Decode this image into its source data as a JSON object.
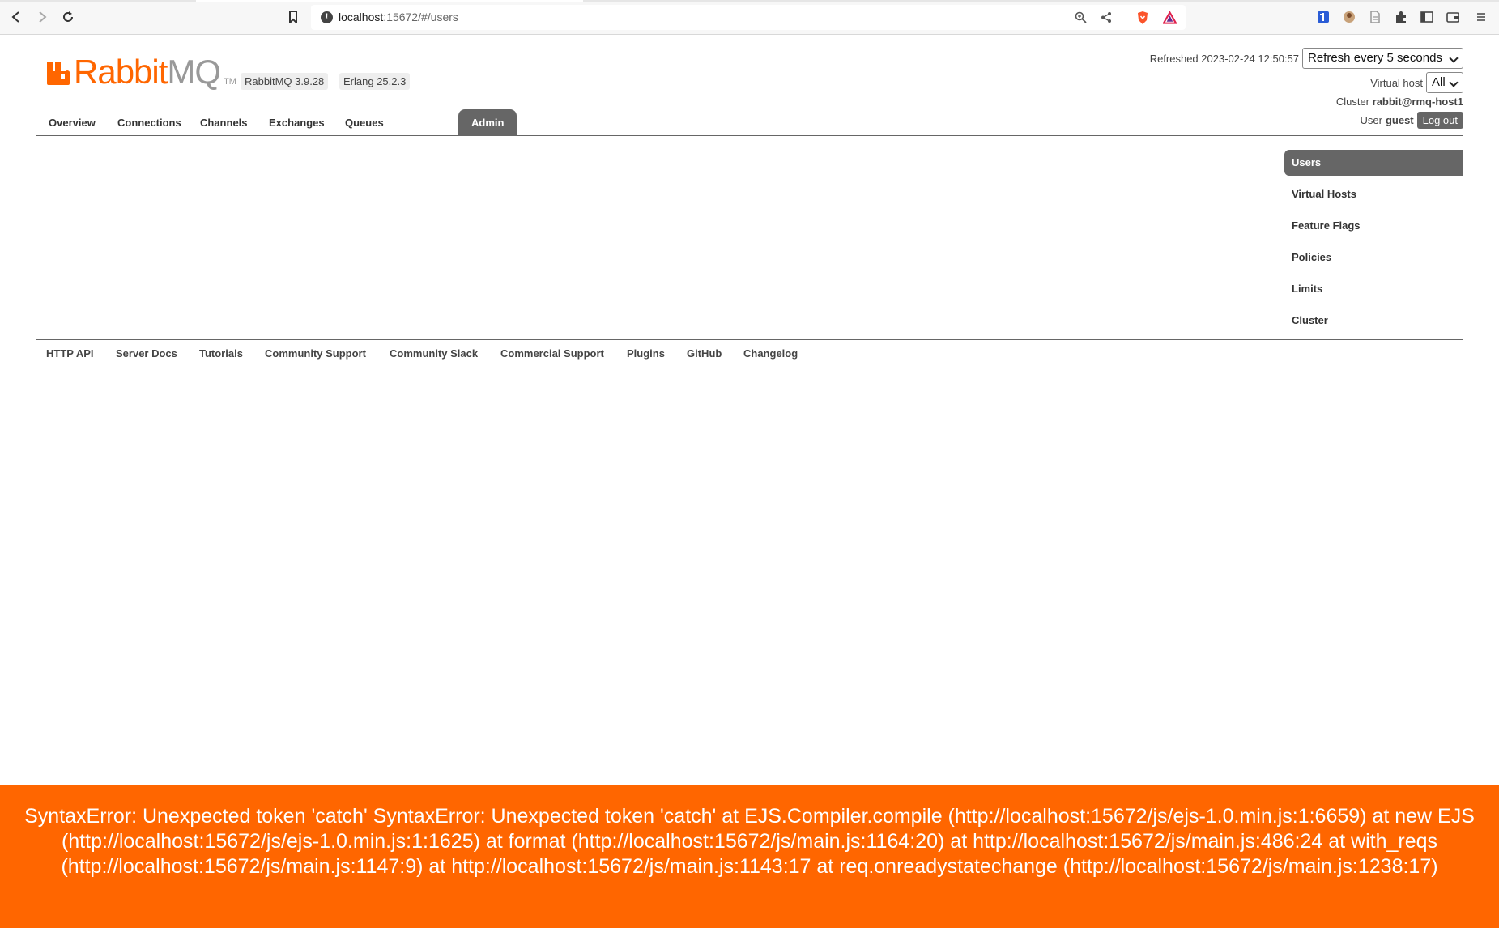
{
  "browser": {
    "url_host": "localhost",
    "url_rest": ":15672/#/users"
  },
  "header": {
    "logo_rabbit": "Rabbit",
    "logo_mq": "MQ",
    "logo_tm": "TM",
    "rabbitmq_version": "RabbitMQ 3.9.28",
    "erlang_version": "Erlang 25.2.3",
    "refreshed_label": "Refreshed 2023-02-24 12:50:57",
    "refresh_select": "Refresh every 5 seconds",
    "vhost_label": "Virtual host",
    "vhost_select": "All",
    "cluster_label": "Cluster",
    "cluster_name": "rabbit@rmq-host1",
    "user_label": "User",
    "user_name": "guest",
    "logout_label": "Log out"
  },
  "tabs": [
    "Overview",
    "Connections",
    "Channels",
    "Exchanges",
    "Queues",
    "Admin"
  ],
  "active_tab": "Admin",
  "side_menu": [
    "Users",
    "Virtual Hosts",
    "Feature Flags",
    "Policies",
    "Limits",
    "Cluster"
  ],
  "active_side": "Users",
  "footer_links": [
    "HTTP API",
    "Server Docs",
    "Tutorials",
    "Community Support",
    "Community Slack",
    "Commercial Support",
    "Plugins",
    "GitHub",
    "Changelog"
  ],
  "error_message": "SyntaxError: Unexpected token 'catch' SyntaxError: Unexpected token 'catch' at EJS.Compiler.compile (http://localhost:15672/js/ejs-1.0.min.js:1:6659) at new EJS (http://localhost:15672/js/ejs-1.0.min.js:1:1625) at format (http://localhost:15672/js/main.js:1164:20) at http://localhost:15672/js/main.js:486:24 at with_reqs (http://localhost:15672/js/main.js:1147:9) at http://localhost:15672/js/main.js:1143:17 at req.onreadystatechange (http://localhost:15672/js/main.js:1238:17)",
  "colors": {
    "brand": "#ff6600",
    "nav_active": "#666666"
  }
}
